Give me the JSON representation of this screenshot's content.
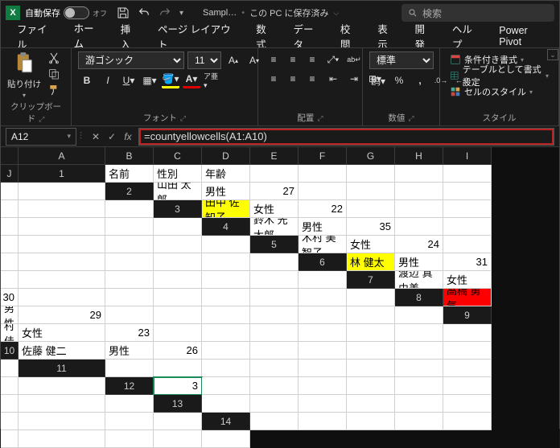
{
  "title": {
    "autosave_label": "自動保存",
    "autosave_state": "オフ",
    "filename": "Sampl…",
    "saved_location": "この PC に保存済み",
    "search_placeholder": "検索"
  },
  "tabs": [
    "ファイル",
    "ホーム",
    "挿入",
    "ページ レイアウト",
    "数式",
    "データ",
    "校閲",
    "表示",
    "開発",
    "ヘルプ",
    "Power Pivot"
  ],
  "active_tab_index": 1,
  "ribbon": {
    "clipboard": {
      "paste": "貼り付け",
      "group": "クリップボード"
    },
    "font": {
      "name": "游ゴシック",
      "size": "11",
      "group": "フォント"
    },
    "alignment": {
      "group": "配置"
    },
    "number": {
      "format": "標準",
      "group": "数値"
    },
    "styles": {
      "cond": "条件付き書式",
      "table": "テーブルとして書式設定",
      "cell": "セルのスタイル",
      "group": "スタイル"
    }
  },
  "name_box": "A12",
  "formula": "=countyellowcells(A1:A10)",
  "columns": [
    "A",
    "B",
    "C",
    "D",
    "E",
    "F",
    "G",
    "H",
    "I",
    "J"
  ],
  "rows": [
    {
      "n": 1,
      "cells": [
        "名前",
        "性別",
        "年齢",
        "",
        "",
        "",
        "",
        "",
        "",
        ""
      ],
      "numAt": [],
      "hl": ""
    },
    {
      "n": 2,
      "cells": [
        "山田 太郎",
        "男性",
        "27",
        "",
        "",
        "",
        "",
        "",
        "",
        ""
      ],
      "numAt": [
        2
      ],
      "hl": ""
    },
    {
      "n": 3,
      "cells": [
        "田中 佐知子",
        "女性",
        "22",
        "",
        "",
        "",
        "",
        "",
        "",
        ""
      ],
      "numAt": [
        2
      ],
      "hl": "yellow"
    },
    {
      "n": 4,
      "cells": [
        "鈴木 光太郎",
        "男性",
        "35",
        "",
        "",
        "",
        "",
        "",
        "",
        ""
      ],
      "numAt": [
        2
      ],
      "hl": ""
    },
    {
      "n": 5,
      "cells": [
        "木村 美智子",
        "女性",
        "24",
        "",
        "",
        "",
        "",
        "",
        "",
        ""
      ],
      "numAt": [
        2
      ],
      "hl": ""
    },
    {
      "n": 6,
      "cells": [
        "林 健太",
        "男性",
        "31",
        "",
        "",
        "",
        "",
        "",
        "",
        ""
      ],
      "numAt": [
        2
      ],
      "hl": "yellow"
    },
    {
      "n": 7,
      "cells": [
        "渡辺 真由美",
        "女性",
        "30",
        "",
        "",
        "",
        "",
        "",
        "",
        ""
      ],
      "numAt": [
        2
      ],
      "hl": ""
    },
    {
      "n": 8,
      "cells": [
        "高橋 勇気",
        "男性",
        "29",
        "",
        "",
        "",
        "",
        "",
        "",
        ""
      ],
      "numAt": [
        2
      ],
      "hl": "red"
    },
    {
      "n": 9,
      "cells": [
        "中村 佳子",
        "女性",
        "23",
        "",
        "",
        "",
        "",
        "",
        "",
        ""
      ],
      "numAt": [
        2
      ],
      "hl": ""
    },
    {
      "n": 10,
      "cells": [
        "佐藤 健二",
        "男性",
        "26",
        "",
        "",
        "",
        "",
        "",
        "",
        ""
      ],
      "numAt": [
        2
      ],
      "hl": ""
    },
    {
      "n": 11,
      "cells": [
        "",
        "",
        "",
        "",
        "",
        "",
        "",
        "",
        "",
        ""
      ],
      "numAt": [],
      "hl": ""
    },
    {
      "n": 12,
      "cells": [
        "3",
        "",
        "",
        "",
        "",
        "",
        "",
        "",
        "",
        ""
      ],
      "numAt": [
        0
      ],
      "hl": "",
      "selected": 0
    },
    {
      "n": 13,
      "cells": [
        "",
        "",
        "",
        "",
        "",
        "",
        "",
        "",
        "",
        ""
      ],
      "numAt": [],
      "hl": ""
    },
    {
      "n": 14,
      "cells": [
        "",
        "",
        "",
        "",
        "",
        "",
        "",
        "",
        "",
        ""
      ],
      "numAt": [],
      "hl": ""
    }
  ]
}
